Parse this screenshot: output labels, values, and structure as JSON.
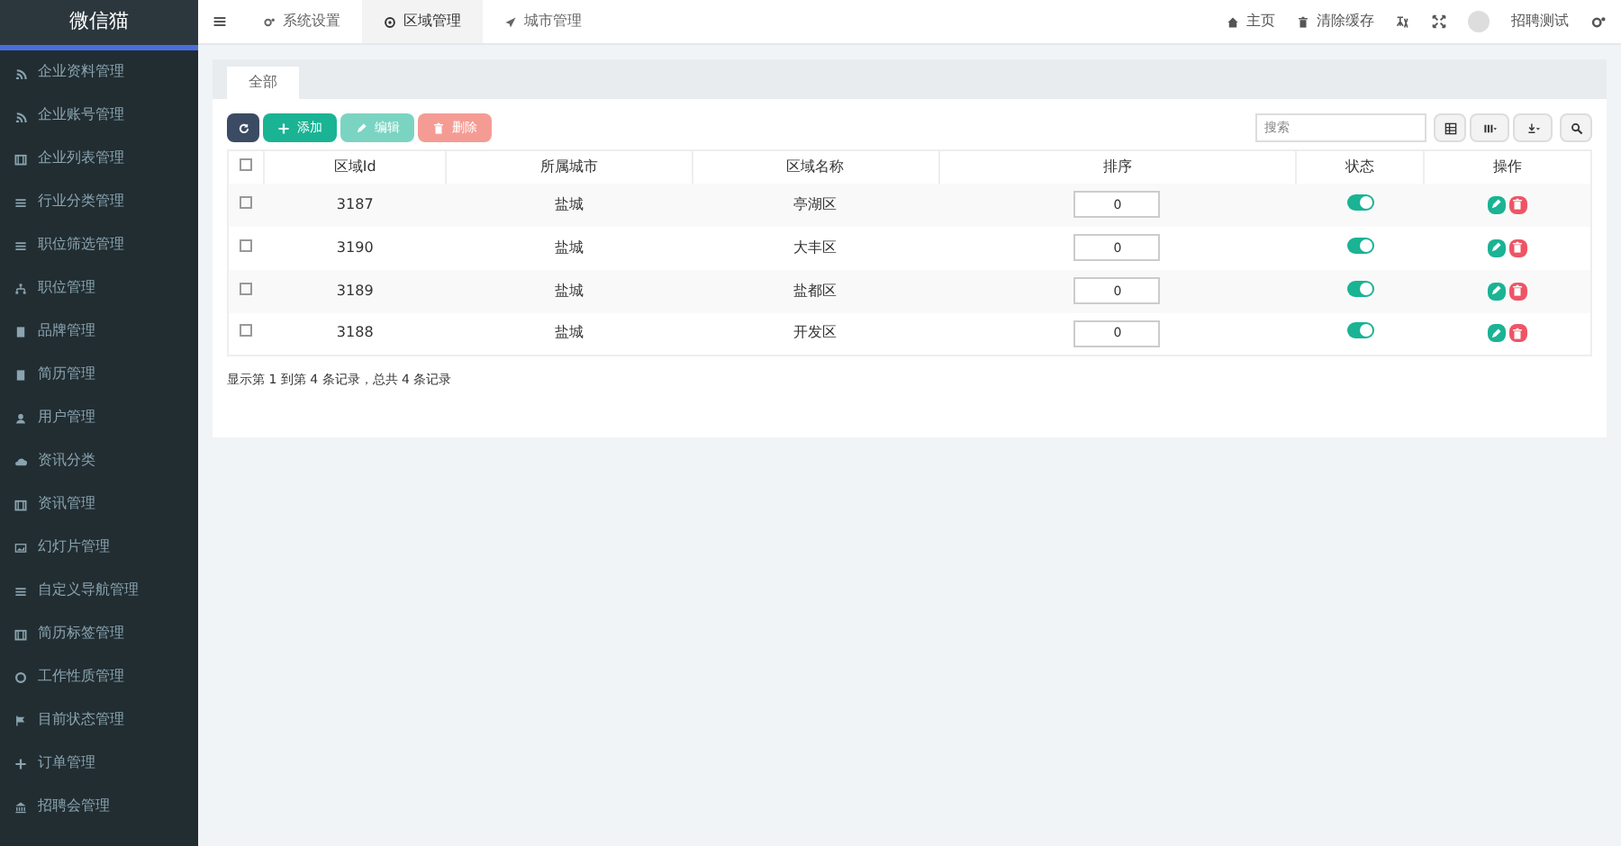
{
  "sidebar": {
    "logo": "微信猫",
    "items": [
      {
        "label": "企业资料管理"
      },
      {
        "label": "企业账号管理"
      },
      {
        "label": "企业列表管理"
      },
      {
        "label": "行业分类管理"
      },
      {
        "label": "职位筛选管理"
      },
      {
        "label": "职位管理"
      },
      {
        "label": "品牌管理"
      },
      {
        "label": "简历管理"
      },
      {
        "label": "用户管理"
      },
      {
        "label": "资讯分类"
      },
      {
        "label": "资讯管理"
      },
      {
        "label": "幻灯片管理"
      },
      {
        "label": "自定义导航管理"
      },
      {
        "label": "简历标签管理"
      },
      {
        "label": "工作性质管理"
      },
      {
        "label": "目前状态管理"
      },
      {
        "label": "订单管理"
      },
      {
        "label": "招聘会管理"
      }
    ]
  },
  "top_tabs": [
    {
      "label": "系统设置",
      "selected": false
    },
    {
      "label": "区域管理",
      "selected": true
    },
    {
      "label": "城市管理",
      "selected": false
    }
  ],
  "top_right": {
    "home": "主页",
    "clear_cache": "清除缓存",
    "user": "招聘测试"
  },
  "panel_tabs": [
    {
      "label": "全部",
      "selected": true
    }
  ],
  "toolbar": {
    "add": "添加",
    "edit": "编辑",
    "delete": "删除",
    "search_placeholder": "搜索"
  },
  "table": {
    "all_selected": false,
    "columns": [
      "区域Id",
      "所属城市",
      "区域名称",
      "排序",
      "状态",
      "操作"
    ],
    "rows": [
      {
        "selected": false,
        "id": "3187",
        "city": "盐城",
        "name": "亭湖区",
        "sort": "0",
        "on": true
      },
      {
        "selected": false,
        "id": "3190",
        "city": "盐城",
        "name": "大丰区",
        "sort": "0",
        "on": true
      },
      {
        "selected": false,
        "id": "3189",
        "city": "盐城",
        "name": "盐都区",
        "sort": "0",
        "on": true
      },
      {
        "selected": false,
        "id": "3188",
        "city": "盐城",
        "name": "开发区",
        "sort": "0",
        "on": true
      }
    ]
  },
  "footer": "显示第 1 到第 4 条记录，总共 4 条记录"
}
